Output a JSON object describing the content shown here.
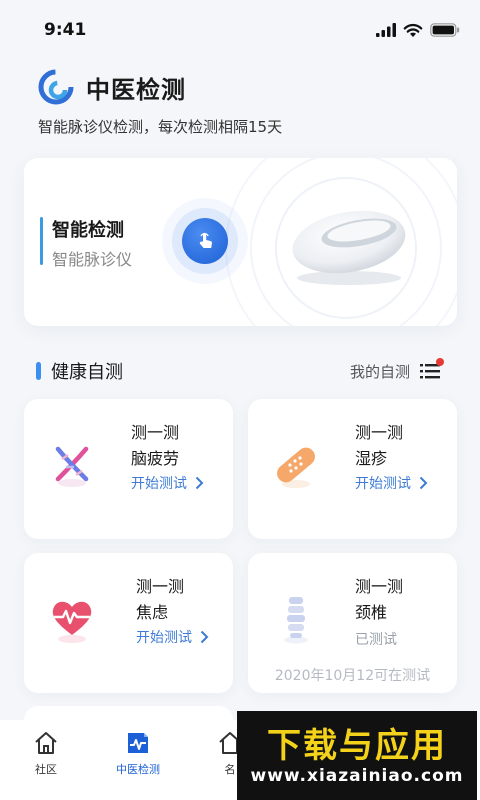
{
  "status_bar": {
    "time": "9:41"
  },
  "header": {
    "app_title": "中医检测",
    "subtitle": "智能脉诊仪检测，每次检测相隔15天"
  },
  "hero": {
    "title": "智能检测",
    "subtitle": "智能脉诊仪"
  },
  "section": {
    "title": "健康自测",
    "my_tests_label": "我的自测",
    "has_notification": true
  },
  "tests": [
    {
      "prefix": "测一测",
      "name": "脑疲劳",
      "action": "开始测试",
      "icon": "brain-dna-icon"
    },
    {
      "prefix": "测一测",
      "name": "湿疹",
      "action": "开始测试",
      "icon": "bandage-icon"
    },
    {
      "prefix": "测一测",
      "name": "焦虑",
      "action": "开始测试",
      "icon": "heart-pulse-icon"
    },
    {
      "prefix": "测一测",
      "name": "颈椎",
      "status": "已测试",
      "note": "2020年10月12可在测试",
      "icon": "spine-icon"
    }
  ],
  "bottom_nav": [
    {
      "label": "社区",
      "icon": "home-icon",
      "active": false
    },
    {
      "label": "中医检测",
      "icon": "pulse-chart-icon",
      "active": true
    },
    {
      "label": "名",
      "icon": "home-icon",
      "active": false
    }
  ],
  "watermark": {
    "main": "下载与应用",
    "url": "www.xiazainiao.com"
  },
  "colors": {
    "accent": "#3e7bd6",
    "primary_blue": "#1c5fd6",
    "notify_red": "#e53935"
  }
}
